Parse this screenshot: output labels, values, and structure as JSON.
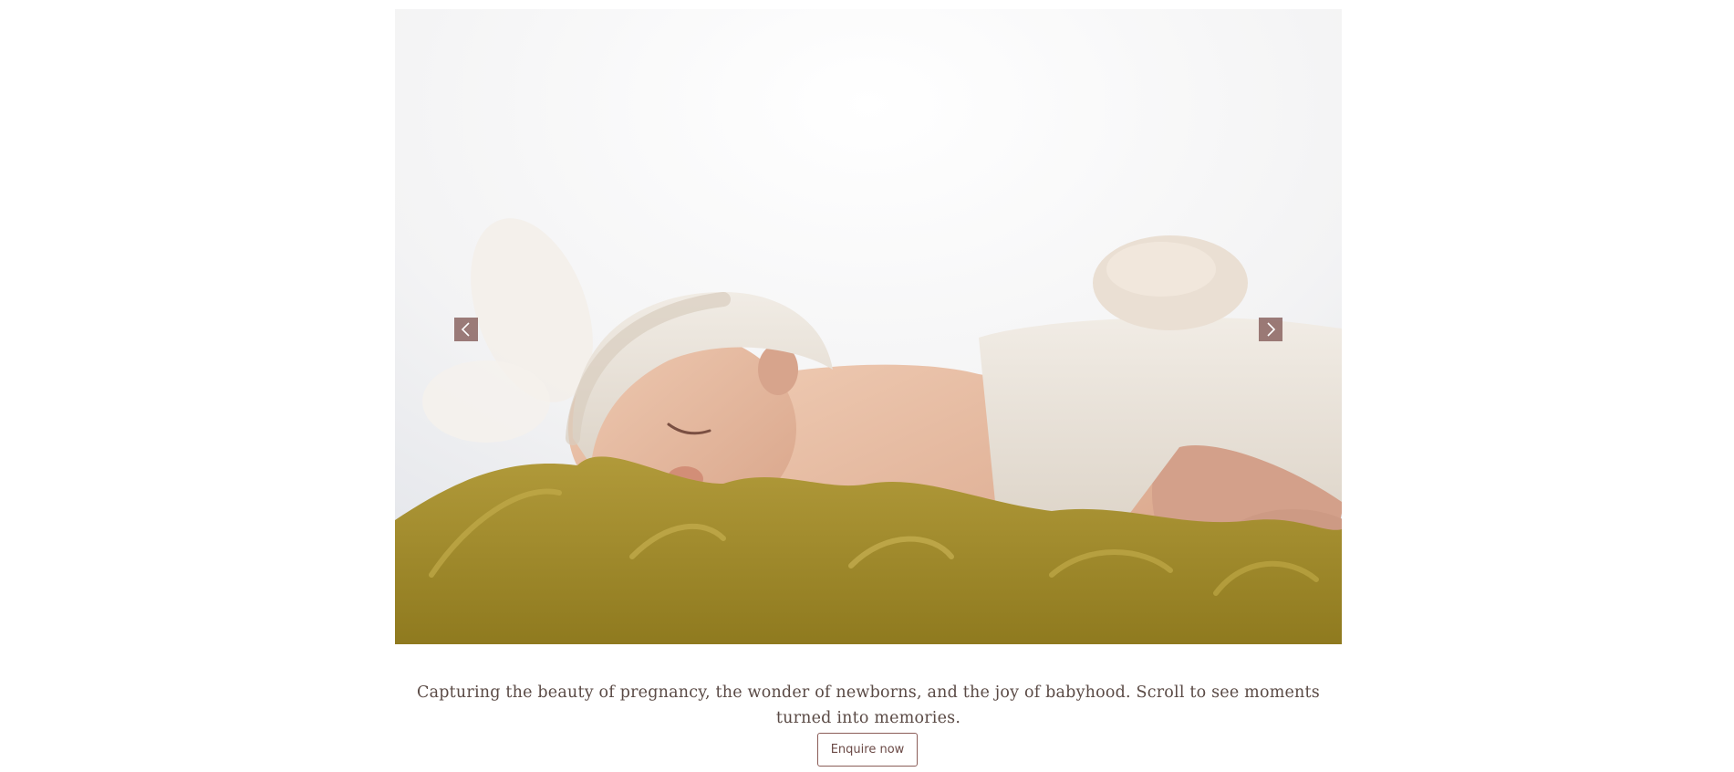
{
  "slider": {
    "image_alt": "",
    "prev_icon": "chevron-left-icon",
    "next_icon": "chevron-right-icon"
  },
  "caption": {
    "text": "Capturing the beauty of pregnancy, the wonder of newborns, and the joy of babyhood. Scroll to see moments turned into memories."
  },
  "cta": {
    "label": "Enquire now"
  },
  "colors": {
    "accent": "#8b6562",
    "text": "#5a4a45",
    "button_border": "#8b5d58"
  }
}
